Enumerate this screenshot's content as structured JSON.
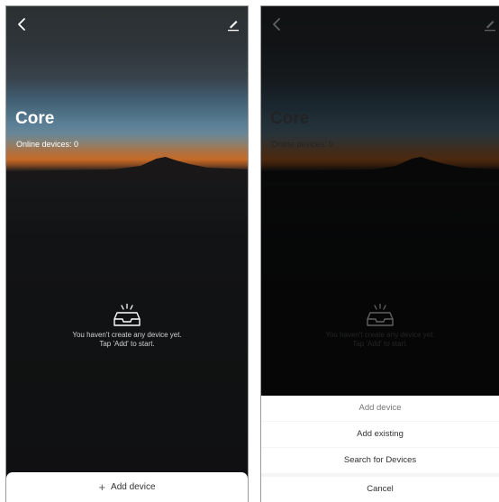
{
  "screen": {
    "title": "Core",
    "online_devices": "Online devices: 0",
    "empty_line1": "You haven't create any device yet.",
    "empty_line2": "Tap 'Add' to start.",
    "add_button_label": "Add device",
    "add_button_plus": "+"
  },
  "sheet": {
    "title": "Add device",
    "options": [
      "Add existing",
      "Search for Devices"
    ],
    "cancel": "Cancel"
  },
  "icons": {
    "back": "back-arrow-icon",
    "edit": "edit-pencil-icon",
    "empty": "empty-inbox-icon"
  },
  "colors": {
    "sheet_bg": "#ffffff",
    "screen_bg": "#0f1011"
  }
}
